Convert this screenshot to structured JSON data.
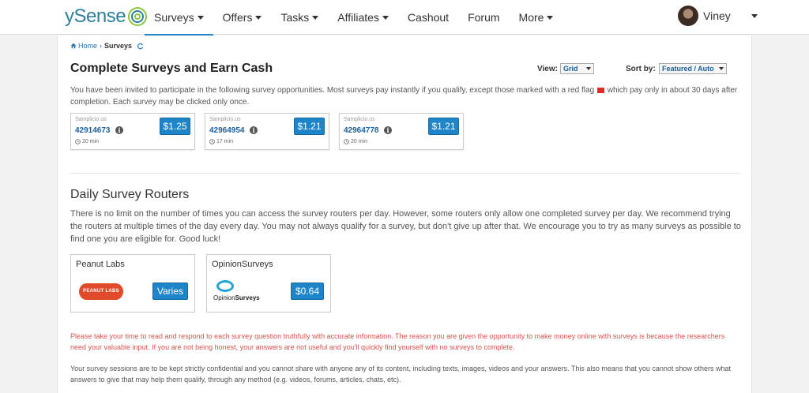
{
  "app": {
    "logo_text": "ySense"
  },
  "nav": {
    "items": [
      {
        "label": "Surveys",
        "has_caret": true
      },
      {
        "label": "Offers",
        "has_caret": true
      },
      {
        "label": "Tasks",
        "has_caret": true
      },
      {
        "label": "Affiliates",
        "has_caret": true
      },
      {
        "label": "Cashout",
        "has_caret": false
      },
      {
        "label": "Forum",
        "has_caret": false
      },
      {
        "label": "More",
        "has_caret": true
      }
    ],
    "user_name": "Viney"
  },
  "breadcrumb": {
    "home": "Home",
    "separator": "›",
    "current": "Surveys"
  },
  "surveys_section": {
    "title": "Complete Surveys and Earn Cash",
    "view_label": "View:",
    "view_value": "Grid",
    "sort_label": "Sort by:",
    "sort_value": "Featured / Auto",
    "intro_before_flag": "You have been invited to participate in the following survey opportunities. Most surveys pay instantly if you qualify, except those marked with a red flag",
    "intro_after_flag": "which pay only in about 30 days after completion. Each survey may be clicked only once.",
    "cards": [
      {
        "provider": "Samplicio.us",
        "id": "42914673",
        "time": "20 min",
        "price": "$1.25"
      },
      {
        "provider": "Samplicio.us",
        "id": "42964954",
        "time": "17 min",
        "price": "$1.21"
      },
      {
        "provider": "Samplicio.us",
        "id": "42964778",
        "time": "20 min",
        "price": "$1.21"
      }
    ]
  },
  "routers_section": {
    "title": "Daily Survey Routers",
    "text": "There is no limit on the number of times you can access the survey routers per day. However, some routers only allow one completed survey per day. We recommend trying the routers at multiple times of the day every day. You may not always qualify for a survey, but don't give up after that. We encourage you to try as many surveys as possible to find one you are eligible for. Good luck!",
    "routers": [
      {
        "name": "Peanut Labs",
        "logo_text": "PEANUT LABS",
        "button": "Varies"
      },
      {
        "name": "OpinionSurveys",
        "logo_text_a": "Opinion",
        "logo_text_b": "Surveys",
        "button": "$0.64"
      }
    ]
  },
  "notices": {
    "warning": "Please take your time to read and respond to each survey question truthfully with accurate information. The reason you are given the opportunity to make money online with surveys is because the researchers need your valuable input. If you are not being honest, your answers are not useful and you'll quickly find yourself with no surveys to complete.",
    "confidential": "Your survey sessions are to be kept strictly confidential and you cannot share with anyone any of its content, including texts, images, videos and your answers. This also means that you cannot show others what answers to give that may help them qualify, through any method (e.g. videos, forums, articles, chats, etc)."
  },
  "colors": {
    "accent": "#1f85c9",
    "brand": "#2d7f9a",
    "warning": "#d9534f",
    "flag": "#e02b2b"
  }
}
